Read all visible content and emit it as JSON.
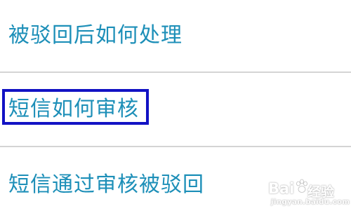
{
  "colors": {
    "link": "#1d8fb8",
    "highlight_box": "#1212c4",
    "divider": "#d4d4d4"
  },
  "list": {
    "items": [
      {
        "label": "被驳回后如何处理"
      },
      {
        "label": "短信如何审核",
        "highlighted": true
      },
      {
        "label": "短信通过审核被驳回"
      }
    ]
  },
  "watermark": {
    "brand": "Bai",
    "brand_suffix": "经验",
    "url": "jingyan.baidu.com"
  }
}
